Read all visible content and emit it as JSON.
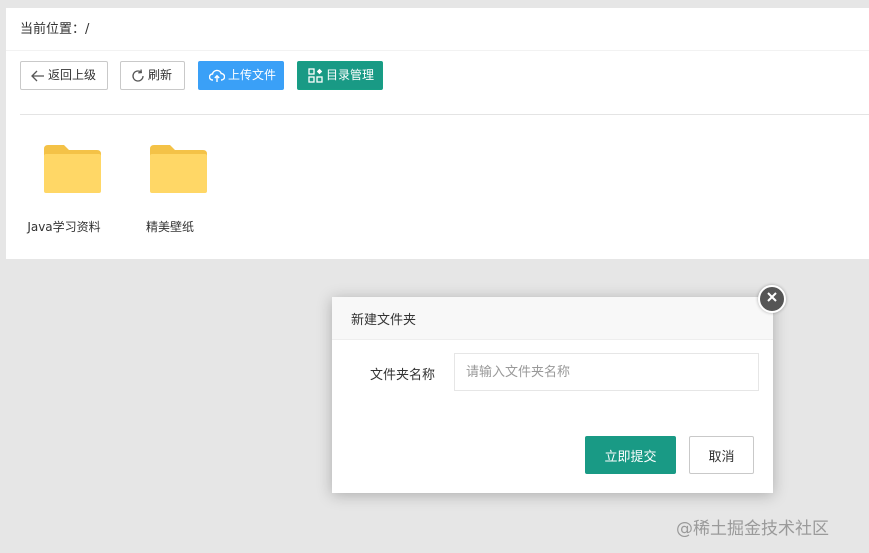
{
  "breadcrumb": {
    "label": "当前位置：",
    "path": "/"
  },
  "toolbar": {
    "back_label": "返回上级",
    "refresh_label": "刷新",
    "upload_label": "上传文件",
    "manage_label": "目录管理"
  },
  "folders": [
    {
      "name": "Java学习资料",
      "icon": "folder-icon"
    },
    {
      "name": "精美壁纸",
      "icon": "folder-icon"
    }
  ],
  "dialog": {
    "title": "新建文件夹",
    "field_label": "文件夹名称",
    "field_value": "",
    "field_placeholder": "请输入文件夹名称",
    "submit_label": "立即提交",
    "cancel_label": "取消"
  },
  "watermark": "@稀土掘金技术社区",
  "colors": {
    "primary_green": "#199a85",
    "upload_blue": "#3aa0f7",
    "folder_yellow": "#ffd766",
    "backdrop": "#e6e6e6"
  }
}
